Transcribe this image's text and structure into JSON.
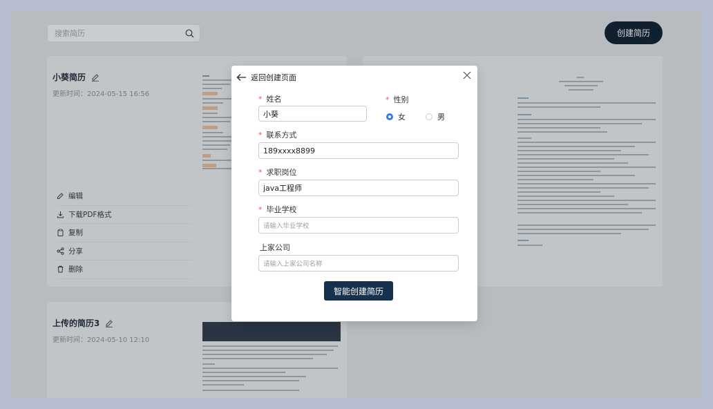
{
  "toolbar": {
    "search_placeholder": "搜索简历",
    "create_label": "创建简历"
  },
  "cards": [
    {
      "title": "小葵简历",
      "time": "更新时间：2024-05-15 16:56"
    },
    {
      "title": "上传的简历3",
      "time": "更新时间：2024-05-10 12:10"
    }
  ],
  "actions": [
    {
      "label": "编辑",
      "icon": "edit-icon"
    },
    {
      "label": "下载PDF格式",
      "icon": "download-icon"
    },
    {
      "label": "复制",
      "icon": "copy-icon"
    },
    {
      "label": "分享",
      "icon": "share-icon"
    },
    {
      "label": "删除",
      "icon": "trash-icon"
    }
  ],
  "modal": {
    "back_label": "返回创建页面",
    "name_label": "姓名",
    "name_value": "小葵",
    "gender_label": "性别",
    "gender_female": "女",
    "gender_male": "男",
    "gender_selected": "女",
    "contact_label": "联系方式",
    "contact_value": "189xxxx8899",
    "position_label": "求职岗位",
    "position_value": "java工程师",
    "school_label": "毕业学校",
    "school_placeholder": "请输入毕业学校",
    "company_label": "上家公司",
    "company_placeholder": "请输入上家公司名称",
    "submit_label": "智能创建简历"
  },
  "colors": {
    "primary": "#16314d",
    "radio_accent": "#2f7cf0",
    "required": "#e0594e"
  }
}
